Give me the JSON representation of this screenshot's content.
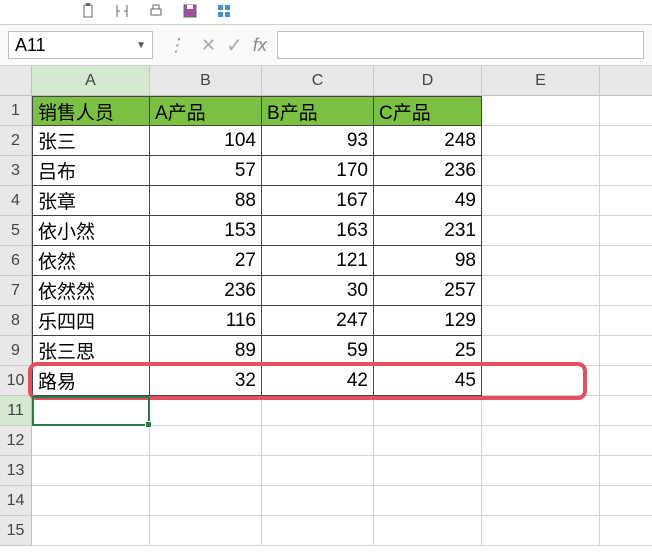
{
  "toolbar_icons": [
    "paste",
    "bracket",
    "print",
    "save",
    "grid"
  ],
  "name_box": {
    "value": "A11"
  },
  "formula": "",
  "fx_label": "fx",
  "fx_x": "✕",
  "fx_tick": "✓",
  "fx_ellipsis": "⋮",
  "columns": [
    "A",
    "B",
    "C",
    "D",
    "E"
  ],
  "row_count": 15,
  "headers": [
    "销售人员",
    "A产品",
    "B产品",
    "C产品"
  ],
  "data_rows": [
    {
      "name": "张三",
      "a": 104,
      "b": 93,
      "c": 248
    },
    {
      "name": "吕布",
      "a": 57,
      "b": 170,
      "c": 236
    },
    {
      "name": "张章",
      "a": 88,
      "b": 167,
      "c": 49
    },
    {
      "name": "依小然",
      "a": 153,
      "b": 163,
      "c": 231
    },
    {
      "name": "依然",
      "a": 27,
      "b": 121,
      "c": 98
    },
    {
      "name": "依然然",
      "a": 236,
      "b": 30,
      "c": 257
    },
    {
      "name": "乐四四",
      "a": 116,
      "b": 247,
      "c": 129
    },
    {
      "name": "张三思",
      "a": 89,
      "b": 59,
      "c": 25
    },
    {
      "name": "路易",
      "a": 32,
      "b": 42,
      "c": 45
    }
  ],
  "active_cell": "A11",
  "highlighted_row": 10
}
